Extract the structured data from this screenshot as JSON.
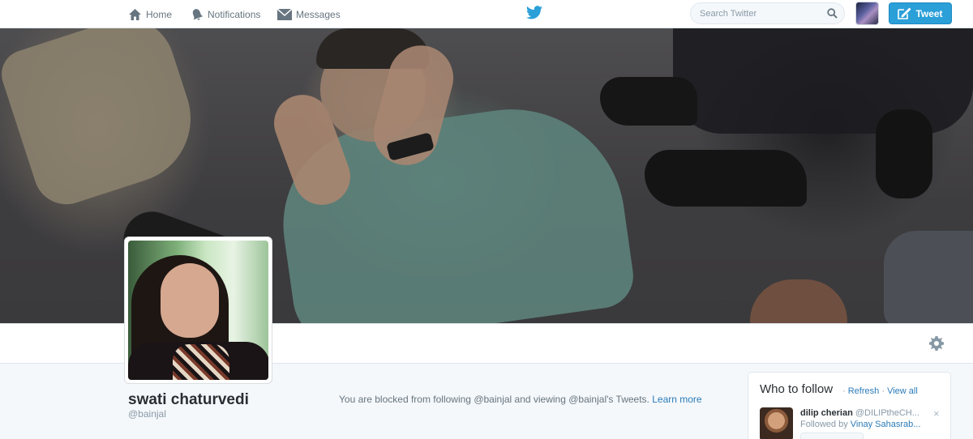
{
  "nav": {
    "home_label": "Home",
    "notifications_label": "Notifications",
    "messages_label": "Messages",
    "search_placeholder": "Search Twitter",
    "tweet_label": "Tweet",
    "brand_color": "#2b9fd8"
  },
  "profile": {
    "name": "swati chaturvedi",
    "handle": "@bainjal"
  },
  "blocked": {
    "message": "You are blocked from following @bainjal and viewing @bainjal's Tweets.",
    "learn_more": "Learn more"
  },
  "who_to_follow": {
    "title": "Who to follow",
    "separator": "·",
    "refresh": "Refresh",
    "view_all": "View all",
    "suggestion": {
      "name": "dilip cherian",
      "handle": "@DILIPtheCH...",
      "followed_by_label": "Followed by",
      "followed_by_name": "Vinay Sahasrab...",
      "close": "×"
    }
  },
  "icons": {
    "home": "home-icon",
    "notifications": "bell-icon",
    "messages": "envelope-icon",
    "brand": "twitter-bird-icon",
    "search": "search-icon",
    "compose": "compose-icon",
    "settings": "gear-icon"
  }
}
